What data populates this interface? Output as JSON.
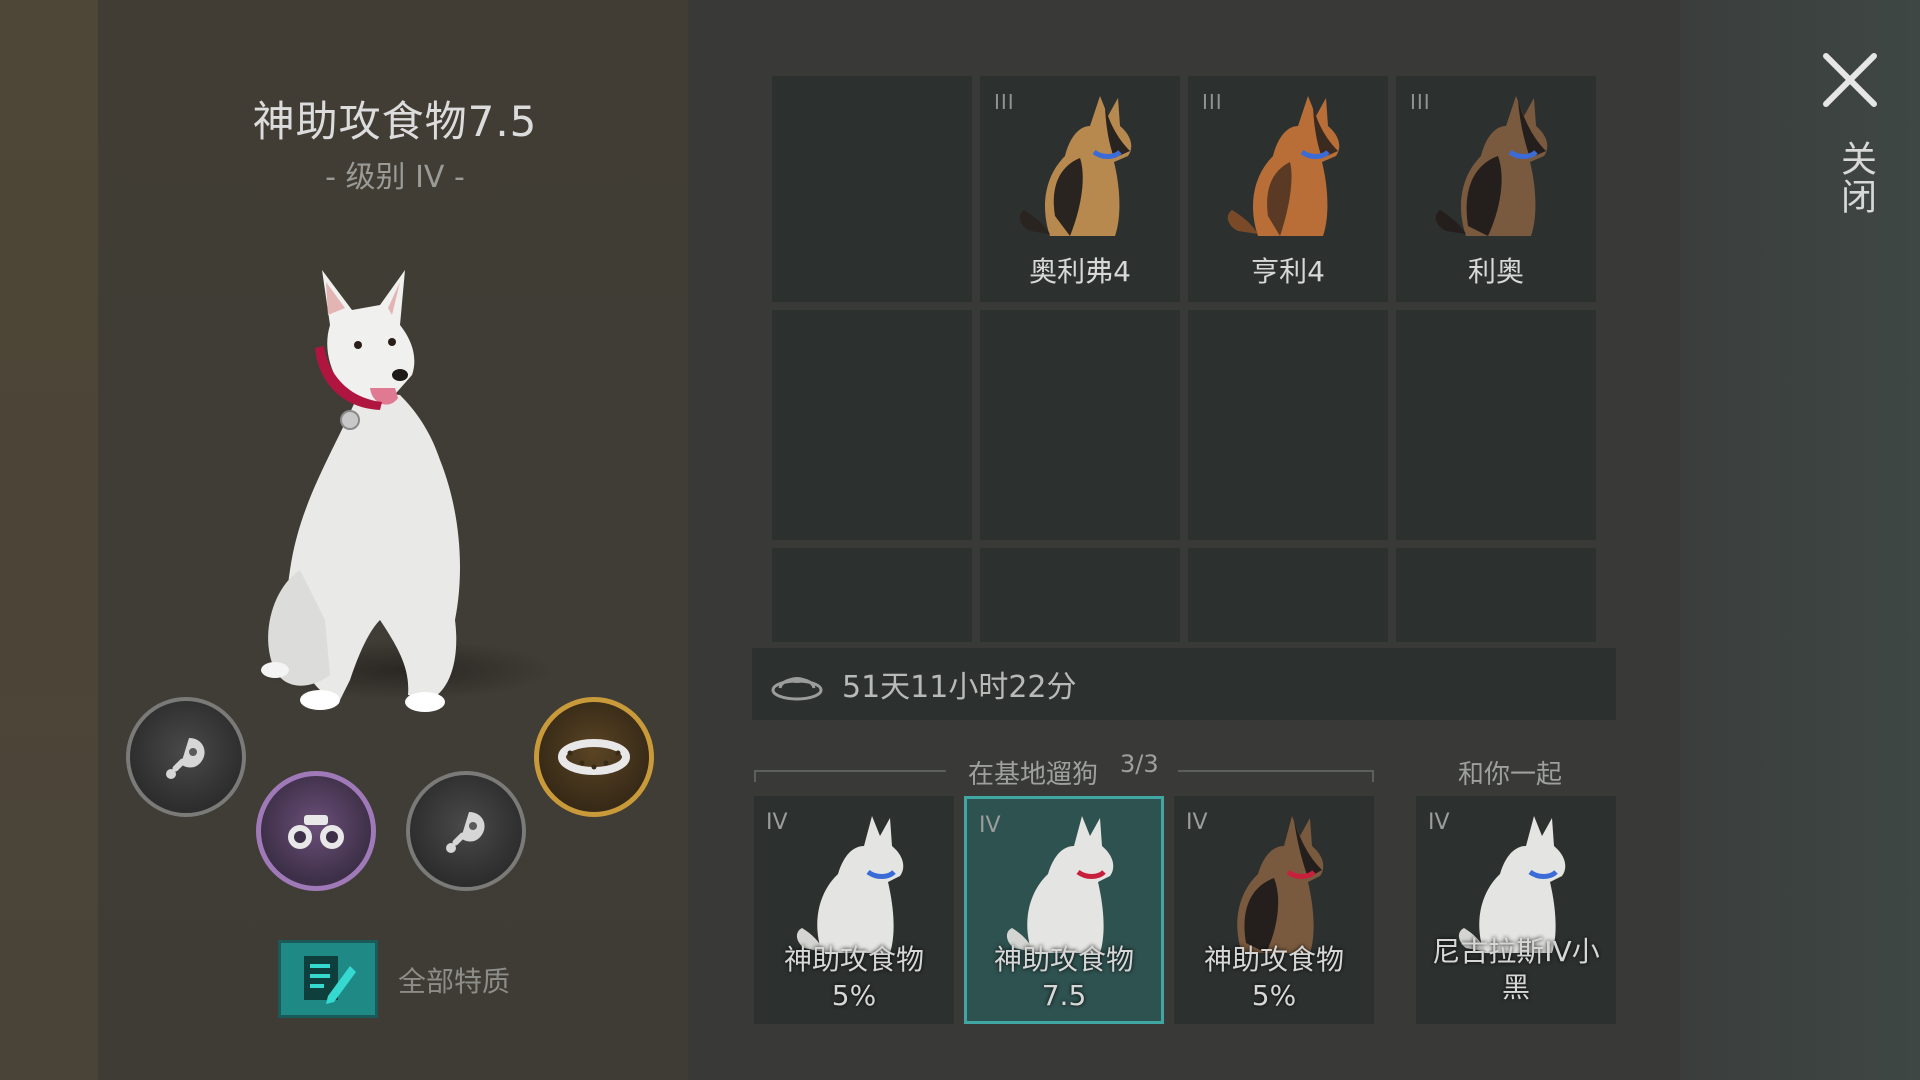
{
  "dog": {
    "name": "神助攻食物7.5",
    "level": "- 级别 IV -"
  },
  "skills": [
    {
      "icon": "meat-icon",
      "rarity": "gray"
    },
    {
      "icon": "binoculars-icon",
      "rarity": "purple"
    },
    {
      "icon": "meat-icon",
      "rarity": "gray"
    },
    {
      "icon": "collar-icon",
      "rarity": "gold"
    }
  ],
  "traits": {
    "label": "全部特质"
  },
  "kennel": {
    "dogs": [
      {
        "tier": "III",
        "name": "奥利弗4"
      },
      {
        "tier": "III",
        "name": "亨利4"
      },
      {
        "tier": "III",
        "name": "利奥"
      }
    ]
  },
  "timer": {
    "icon": "food-bowl-icon",
    "text": "51天11小时22分"
  },
  "walking": {
    "label": "在基地遛狗",
    "count": "3/3",
    "dogs": [
      {
        "tier": "IV",
        "name_line1": "神助攻食物",
        "name_line2": "5%"
      },
      {
        "tier": "IV",
        "name_line1": "神助攻食物",
        "name_line2": "7.5"
      },
      {
        "tier": "IV",
        "name_line1": "神助攻食物",
        "name_line2": "5%"
      }
    ]
  },
  "with_you": {
    "label": "和你一起",
    "dog": {
      "tier": "IV",
      "name_line1": "尼古拉斯IV小",
      "name_line2": "黑"
    }
  },
  "close": {
    "label": "关闭"
  },
  "colors": {
    "accent_teal": "#3fa6a2",
    "skill_purple": "#a07ab8",
    "skill_gold": "#c99a3a"
  }
}
